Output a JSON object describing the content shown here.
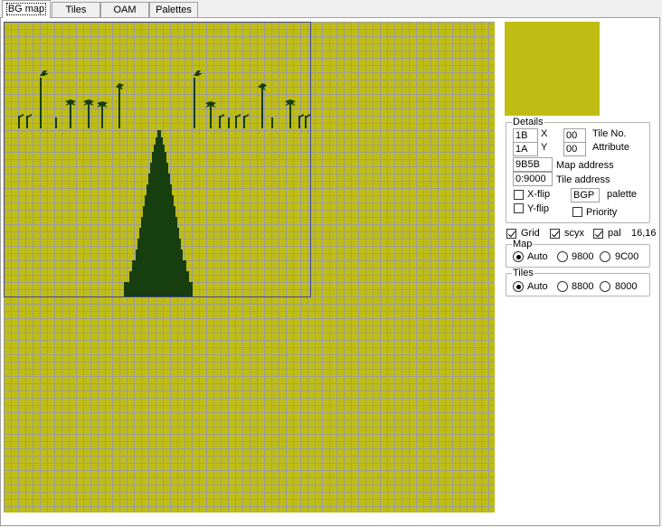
{
  "tabs": [
    {
      "label": "BG map",
      "active": true
    },
    {
      "label": "Tiles",
      "active": false
    },
    {
      "label": "OAM",
      "active": false
    },
    {
      "label": "Palettes",
      "active": false
    }
  ],
  "colors": {
    "background": "#bfbd13",
    "foreground": "#173e0f",
    "grid": "#9c9c9c",
    "viewport": "#4040a0"
  },
  "details": {
    "title": "Details",
    "x_value": "1B",
    "x_label": "X",
    "y_value": "1A",
    "y_label": "Y",
    "tile_no_value": "00",
    "tile_no_label": "Tile No.",
    "attribute_value": "00",
    "attribute_label": "Attribute",
    "map_address_value": "9B5B",
    "map_address_label": "Map address",
    "tile_address_value": "0:9000",
    "tile_address_label": "Tile address",
    "xflip_label": "X-flip",
    "xflip_checked": false,
    "yflip_label": "Y-flip",
    "yflip_checked": false,
    "palette_value": "BGP",
    "palette_label": "palette",
    "priority_label": "Priority",
    "priority_checked": false
  },
  "options": {
    "grid_label": "Grid",
    "grid_checked": true,
    "scyx_label": "scyx",
    "scyx_checked": true,
    "pal_label": "pal",
    "pal_checked": true,
    "coords": "16,16"
  },
  "map_group": {
    "title": "Map",
    "options": [
      "Auto",
      "9800",
      "9C00"
    ],
    "selected": "Auto"
  },
  "tiles_group": {
    "title": "Tiles",
    "options": [
      "Auto",
      "8800",
      "8000"
    ],
    "selected": "Auto"
  }
}
